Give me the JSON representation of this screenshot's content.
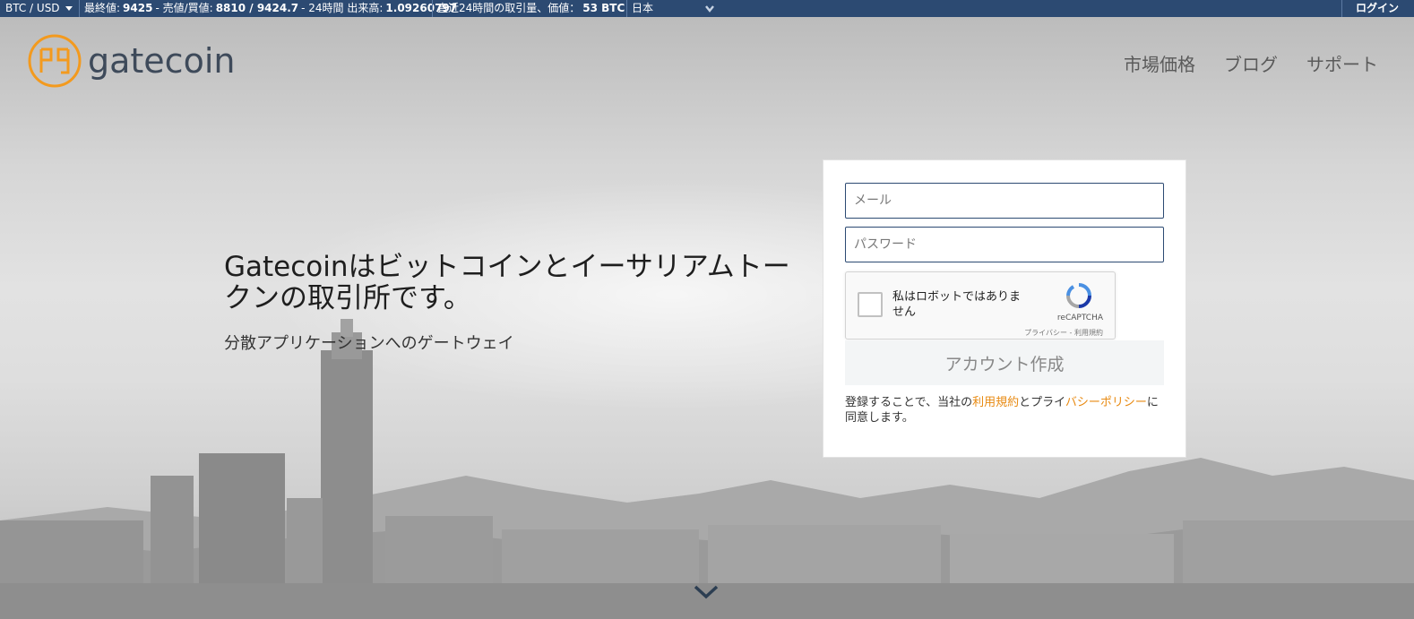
{
  "ticker": {
    "pair": "BTC / USD",
    "last_label": "最終値:",
    "last_value": "9425",
    "bidask_label": "- 売値/買値:",
    "bidask_value": "8810 / 9424.7",
    "volume_label": "- 24時間 出来高:",
    "volume_value": "1.09260797",
    "trades_label": "直近24時間の取引量、価値：",
    "trades_value": "53 BTC",
    "language": "日本",
    "login": "ログイン"
  },
  "header": {
    "logo_text": "gatecoin",
    "nav": [
      "市場価格",
      "ブログ",
      "サポート"
    ]
  },
  "hero": {
    "headline": "Gatecoinはビットコインとイーサリアムトークンの取引所です。",
    "subline": "分散アプリケーションへのゲートウェイ"
  },
  "signup": {
    "email_placeholder": "メール",
    "password_placeholder": "パスワード",
    "captcha_label": "私はロボットではありません",
    "captcha_brand": "reCAPTCHA",
    "captcha_privacy": "プライバシー",
    "captcha_sep": " - ",
    "captcha_terms": "利用規約",
    "submit_label": "アカウント作成",
    "terms_prefix": "登録することで、当社の",
    "terms_link": "利用規約",
    "terms_mid": "とプライ",
    "privacy_link": "バシーポリシー",
    "terms_suffix": "に同意します。"
  },
  "colors": {
    "ticker_bg": "#2c4a72",
    "accent": "#e88a12",
    "logo_orange": "#f39a1e"
  }
}
